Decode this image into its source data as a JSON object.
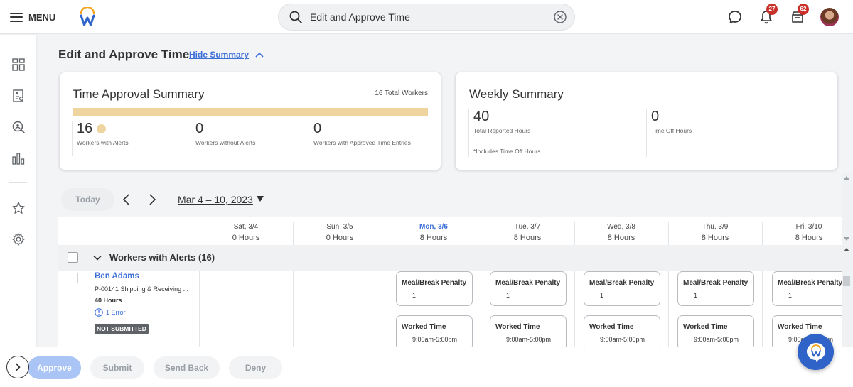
{
  "topbar": {
    "menu_label": "MENU",
    "search_value": "Edit and Approve Time",
    "notifications_count": "27",
    "inbox_count": "62"
  },
  "page": {
    "title": "Edit and Approve Time",
    "hide_summary_label": "Hide Summary"
  },
  "time_approval_summary": {
    "title": "Time Approval Summary",
    "total_workers": "16 Total Workers",
    "progress_fraction_with_alerts": 1.0,
    "metrics": [
      {
        "value": "16",
        "label": "Workers with Alerts"
      },
      {
        "value": "0",
        "label": "Workers without Alerts"
      },
      {
        "value": "0",
        "label": "Workers with Approved Time Entries"
      }
    ],
    "accent_color": "#eed5a0"
  },
  "weekly_summary": {
    "title": "Weekly Summary",
    "metrics": [
      {
        "value": "40",
        "label": "Total Reported Hours"
      },
      {
        "value": "0",
        "label": "Time Off Hours"
      }
    ],
    "note": "*Includes Time Off Hours."
  },
  "date_nav": {
    "today_label": "Today",
    "range": "Mar 4 – 10, 2023"
  },
  "days": [
    {
      "label": "Sat, 3/4",
      "hours": "0 Hours"
    },
    {
      "label": "Sun, 3/5",
      "hours": "0 Hours"
    },
    {
      "label": "Mon, 3/6",
      "hours": "8 Hours"
    },
    {
      "label": "Tue, 3/7",
      "hours": "8 Hours"
    },
    {
      "label": "Wed, 3/8",
      "hours": "8 Hours"
    },
    {
      "label": "Thu, 3/9",
      "hours": "8 Hours"
    },
    {
      "label": "Fri, 3/10",
      "hours": "8 Hours"
    }
  ],
  "group": {
    "title": "Workers with Alerts (16)"
  },
  "worker": {
    "name": "Ben Adams",
    "position": "P-00141 Shipping & Receiving ...",
    "hours": "40 Hours",
    "error": "1 Error",
    "status": "NOT SUBMITTED"
  },
  "entries": {
    "penalty_title": "Meal/Break Penalty",
    "penalty_value": "1",
    "worked_title": "Worked Time",
    "worked_value": "9:00am-5:00pm"
  },
  "actions": {
    "approve": "Approve",
    "submit": "Submit",
    "send_back": "Send Back",
    "deny": "Deny"
  },
  "colors": {
    "brand_blue": "#3c6fd8",
    "badge_red": "#c9312a"
  }
}
